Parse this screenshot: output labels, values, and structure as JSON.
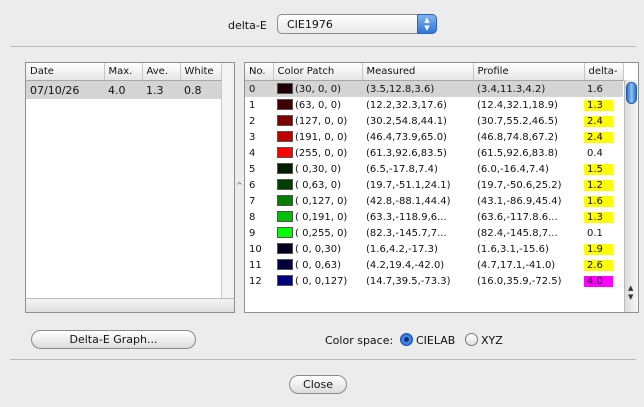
{
  "top": {
    "delta_e_label": "delta-E",
    "delta_e_value": "CIE1976"
  },
  "left_table": {
    "columns": [
      "Date",
      "Max.",
      "Ave.",
      "White"
    ],
    "rows": [
      {
        "date": "07/10/26",
        "max": "4.0",
        "ave": "1.3",
        "white": "0.8"
      }
    ]
  },
  "right_table": {
    "columns": [
      "No.",
      "Color Patch",
      "Measured",
      "Profile",
      "delta-"
    ],
    "rows": [
      {
        "no": "0",
        "patch": "(30, 0, 0)",
        "color": "#1e0000",
        "measured": "(3.5,12.8,3.6)",
        "profile": "(3.4,11.3,4.2)",
        "de": "1.6",
        "de_color": "",
        "selected": true
      },
      {
        "no": "1",
        "patch": "(63, 0, 0)",
        "color": "#3f0000",
        "measured": "(12.2,32.3,17.6)",
        "profile": "(12.4,32.1,18.9)",
        "de": "1.3",
        "de_color": "#ffff00",
        "selected": false
      },
      {
        "no": "2",
        "patch": "(127, 0, 0)",
        "color": "#7f0000",
        "measured": "(30.2,54.8,44.1)",
        "profile": "(30.7,55.2,46.5)",
        "de": "2.4",
        "de_color": "#ffff00",
        "selected": false
      },
      {
        "no": "3",
        "patch": "(191, 0, 0)",
        "color": "#bf0000",
        "measured": "(46.4,73.9,65.0)",
        "profile": "(46.8,74.8,67.2)",
        "de": "2.4",
        "de_color": "#ffff00",
        "selected": false
      },
      {
        "no": "4",
        "patch": "(255, 0, 0)",
        "color": "#ff0000",
        "measured": "(61.3,92.6,83.5)",
        "profile": "(61.5,92.6,83.8)",
        "de": "0.4",
        "de_color": "",
        "selected": false
      },
      {
        "no": "5",
        "patch": "( 0,30, 0)",
        "color": "#001e00",
        "measured": "(6.5,-17.8,7.4)",
        "profile": "(6.0,-16.4,7.4)",
        "de": "1.5",
        "de_color": "#ffff00",
        "selected": false
      },
      {
        "no": "6",
        "patch": "( 0,63, 0)",
        "color": "#003f00",
        "measured": "(19.7,-51.1,24.1)",
        "profile": "(19.7,-50.6,25.2)",
        "de": "1.2",
        "de_color": "#ffff00",
        "selected": false
      },
      {
        "no": "7",
        "patch": "( 0,127, 0)",
        "color": "#007f00",
        "measured": "(42.8,-88.1,44.4)",
        "profile": "(43.1,-86.9,45.4)",
        "de": "1.6",
        "de_color": "#ffff00",
        "selected": false
      },
      {
        "no": "8",
        "patch": "( 0,191, 0)",
        "color": "#00bf00",
        "measured": "(63.3,-118.9,6...",
        "profile": "(63.6,-117.8.6...",
        "de": "1.3",
        "de_color": "#ffff00",
        "selected": false
      },
      {
        "no": "9",
        "patch": "( 0,255, 0)",
        "color": "#00ff00",
        "measured": "(82.3,-145.7,7...",
        "profile": "(82.4,-145.8,7...",
        "de": "0.1",
        "de_color": "",
        "selected": false
      },
      {
        "no": "10",
        "patch": "( 0, 0,30)",
        "color": "#00001e",
        "measured": "(1.6,4.2,-17.3)",
        "profile": "(1.6,3.1,-15.6)",
        "de": "1.9",
        "de_color": "#ffff00",
        "selected": false
      },
      {
        "no": "11",
        "patch": "( 0, 0,63)",
        "color": "#00003f",
        "measured": "(4.2,19.4,-42.0)",
        "profile": "(4.7,17.1,-41.0)",
        "de": "2.6",
        "de_color": "#ffff00",
        "selected": false
      },
      {
        "no": "12",
        "patch": "( 0, 0,127)",
        "color": "#00007f",
        "measured": "(14.7,39.5,-73.3)",
        "profile": "(16.0,35.9,-72.5)",
        "de": "4.0",
        "de_color": "#ff00ff",
        "selected": false
      }
    ]
  },
  "buttons": {
    "graph": "Delta-E Graph...",
    "close": "Close"
  },
  "color_space": {
    "label": "Color space:",
    "options": [
      "CIELAB",
      "XYZ"
    ],
    "selected": "CIELAB"
  },
  "colors": {
    "selection": "#d4d4d4",
    "highlight_yellow": "#ffff00",
    "highlight_magenta": "#ff00ff",
    "accent_blue": "#2f76d6"
  }
}
